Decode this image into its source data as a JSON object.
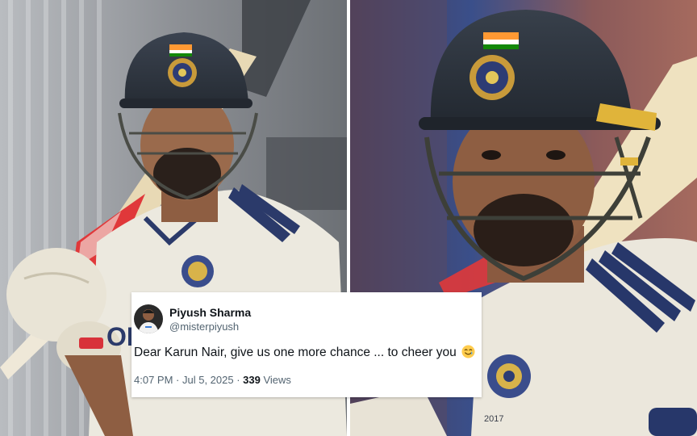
{
  "left_photo": {
    "subject": "Cricketer in dark blue helmet with Indian flag and white test jersey, bat over shoulder",
    "colors": {
      "background": "#8d9094",
      "helmet": "#2f3640",
      "jersey": "#ece9df",
      "skin": "#9a6a4c",
      "grip_red": "#e0383a"
    }
  },
  "right_photo": {
    "subject": "Close-up of cricketer in helmet with grille and white test jersey",
    "colors": {
      "background": "#6d4a4a",
      "helmet": "#2b323b",
      "jersey": "#ebe7dc",
      "skin": "#8e5e42",
      "grille": "#3d3f38"
    }
  },
  "tweet": {
    "display_name": "Piyush Sharma",
    "handle": "@misterpiyush",
    "text": "Dear Karun Nair, give us one more chance ... to cheer you",
    "emoji": "smiling-face-with-tear",
    "time": "4:07 PM",
    "separator_1": " · ",
    "date": "Jul 5, 2025",
    "separator_2": " · ",
    "views_count": "339",
    "views_label": " Views"
  }
}
